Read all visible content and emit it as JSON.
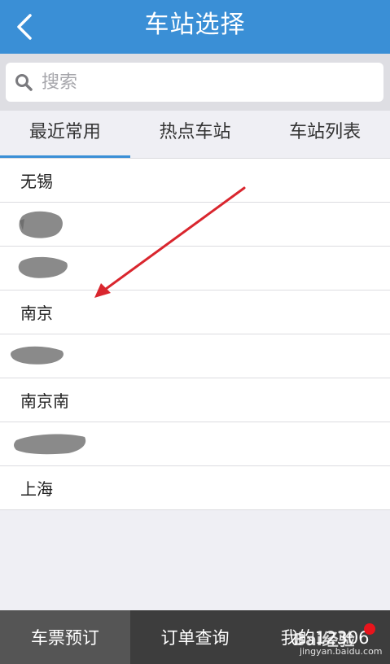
{
  "header": {
    "title": "车站选择",
    "back_icon": "chevron-left-icon"
  },
  "search": {
    "placeholder": "搜索",
    "value": ""
  },
  "tabs": [
    {
      "label": "最近常用",
      "active": true
    },
    {
      "label": "热点车站",
      "active": false
    },
    {
      "label": "车站列表",
      "active": false
    }
  ],
  "stations": [
    {
      "name": "无锡"
    },
    {
      "name": ""
    },
    {
      "name": ""
    },
    {
      "name": "南京"
    },
    {
      "name": ""
    },
    {
      "name": "南京南"
    },
    {
      "name": ""
    },
    {
      "name": "上海"
    }
  ],
  "bottom_nav": [
    {
      "label": "车票预订",
      "active": true
    },
    {
      "label": "订单查询",
      "active": false
    },
    {
      "label": "我的12306",
      "active": false
    }
  ],
  "watermark": {
    "main": "Bai经验",
    "sub": "jingyan.baidu.com"
  },
  "colors": {
    "header_bg": "#3a8fd6",
    "accent": "#3a8fd6",
    "arrow": "#d9262e",
    "bottom_bg": "#3d3d3d",
    "badge": "#e8141c"
  }
}
